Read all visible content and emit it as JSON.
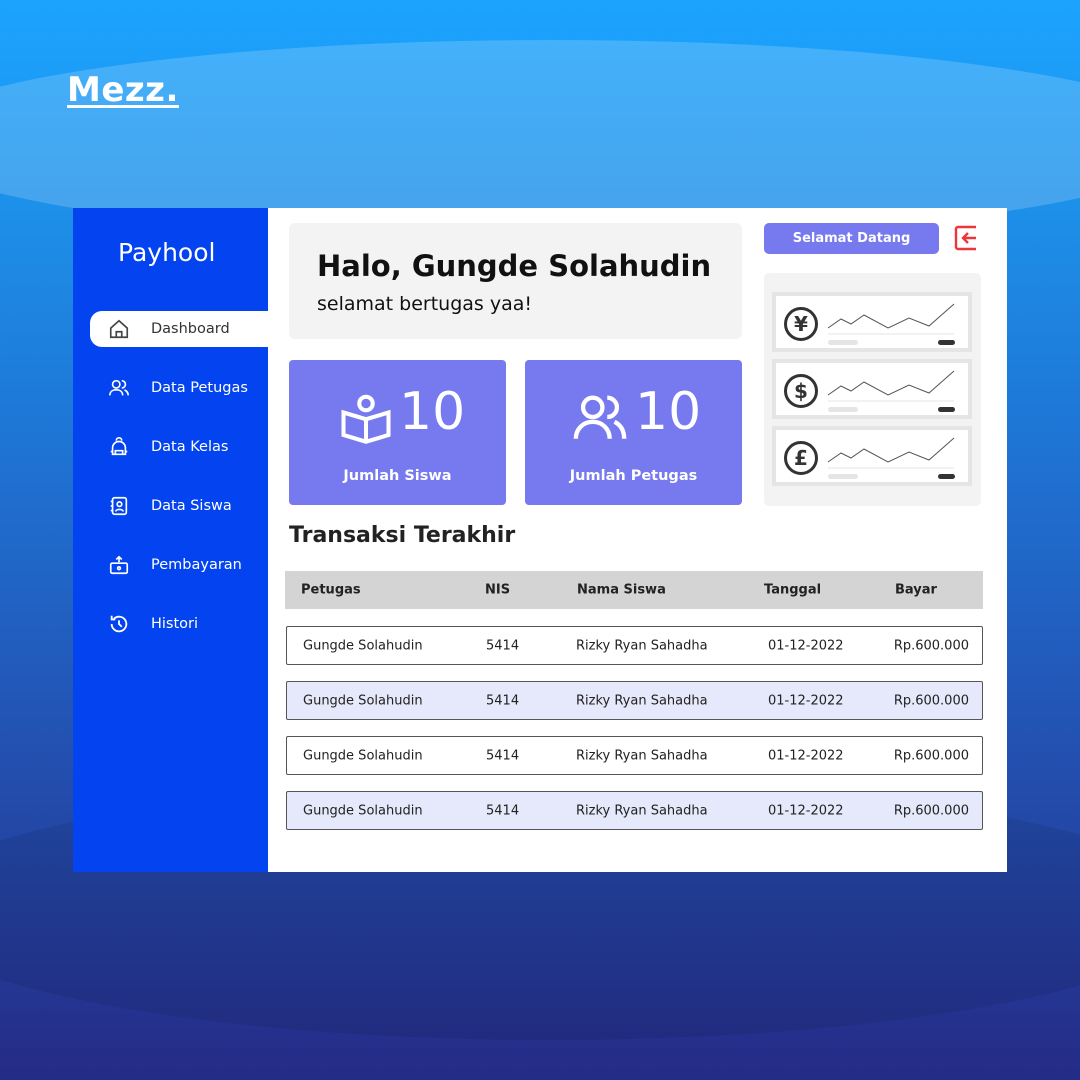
{
  "brand": "Mezz.",
  "app_title": "Payhool",
  "sidebar": {
    "items": [
      {
        "label": "Dashboard",
        "icon": "home-icon",
        "active": true
      },
      {
        "label": "Data Petugas",
        "icon": "users-icon"
      },
      {
        "label": "Data Kelas",
        "icon": "backpack-icon"
      },
      {
        "label": "Data Siswa",
        "icon": "contact-book-icon"
      },
      {
        "label": "Pembayaran",
        "icon": "payment-icon"
      },
      {
        "label": "Histori",
        "icon": "history-icon"
      }
    ]
  },
  "greeting": {
    "title": "Halo, Gungde Solahudin",
    "subtitle": "selamat bertugas yaa!"
  },
  "stats": [
    {
      "value": "10",
      "label": "Jumlah Siswa",
      "icon": "book-reader-icon"
    },
    {
      "value": "10",
      "label": "Jumlah Petugas",
      "icon": "users-icon"
    }
  ],
  "welcome_button": "Selamat Datang",
  "widgets": [
    {
      "icon": "yen-icon",
      "symbol": "¥"
    },
    {
      "icon": "dollar-icon",
      "symbol": "$"
    },
    {
      "icon": "pound-icon",
      "symbol": "£"
    }
  ],
  "colors": {
    "sidebar": "#0344f0",
    "accent": "#7779ee",
    "logout": "#f0353a"
  },
  "transactions": {
    "title": "Transaksi Terakhir",
    "columns": [
      "Petugas",
      "NIS",
      "Nama Siswa",
      "Tanggal",
      "Bayar"
    ],
    "rows": [
      [
        "Gungde Solahudin",
        "5414",
        "Rizky Ryan Sahadha",
        "01-12-2022",
        "Rp.600.000"
      ],
      [
        "Gungde Solahudin",
        "5414",
        "Rizky Ryan Sahadha",
        "01-12-2022",
        "Rp.600.000"
      ],
      [
        "Gungde Solahudin",
        "5414",
        "Rizky Ryan Sahadha",
        "01-12-2022",
        "Rp.600.000"
      ],
      [
        "Gungde Solahudin",
        "5414",
        "Rizky Ryan Sahadha",
        "01-12-2022",
        "Rp.600.000"
      ]
    ]
  }
}
